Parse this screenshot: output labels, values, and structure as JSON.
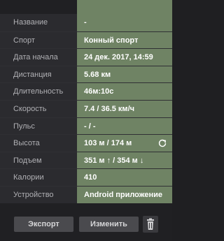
{
  "details": {
    "rows": [
      {
        "label": "Название",
        "value": "-"
      },
      {
        "label": "Спорт",
        "value": "Конный спорт"
      },
      {
        "label": "Дата начала",
        "value": "24 дек. 2017, 14:59"
      },
      {
        "label": "Дистанция",
        "value": "5.68 км"
      },
      {
        "label": "Длительность",
        "value": "46м:10с"
      },
      {
        "label": "Скорость",
        "value": "7.4 / 36.5 км/ч"
      },
      {
        "label": "Пульс",
        "value": "- / -"
      },
      {
        "label": "Высота",
        "value": "103 м / 174 м"
      },
      {
        "label": "Подъем",
        "value": "351 м ↑ / 354 м ↓"
      },
      {
        "label": "Калории",
        "value": "410"
      },
      {
        "label": "Устройство",
        "value": "Android приложение"
      }
    ]
  },
  "actions": {
    "export_label": "Экспорт",
    "edit_label": "Изменить"
  },
  "icons": {
    "refresh": "refresh-icon",
    "delete": "trash-icon"
  },
  "colors": {
    "value_bg": "#6f8364",
    "label_bg": "#2b2b2f",
    "button_bg": "#4a4a4e"
  }
}
